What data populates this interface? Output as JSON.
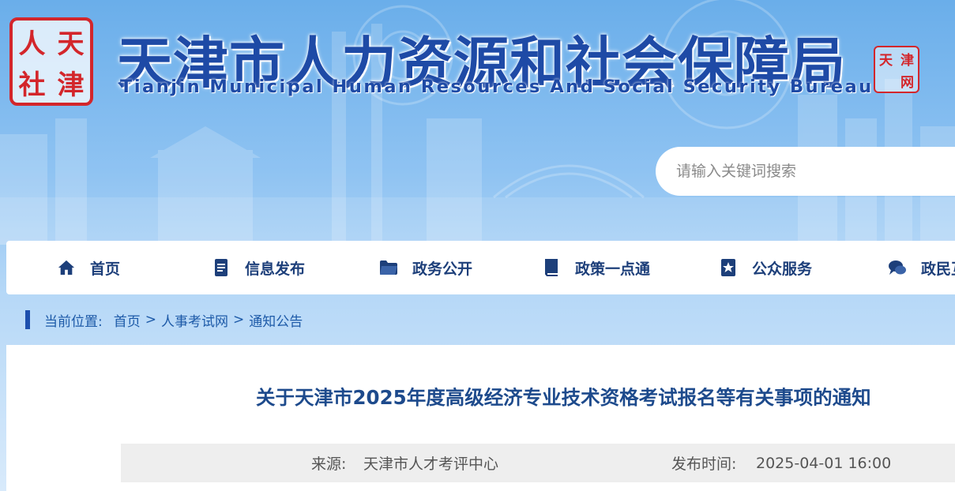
{
  "header": {
    "logo_chars": [
      "人",
      "天",
      "社",
      "津"
    ],
    "title": "天津市人力资源和社会保障局",
    "subtitle": "Tianjin Municipal Human Resources And Social Security Bureau",
    "stamp_chars": [
      "天",
      "津",
      "",
      "网"
    ]
  },
  "search": {
    "placeholder": "请输入关键词搜索"
  },
  "nav": {
    "items": [
      {
        "label": "首页",
        "icon": "home-icon"
      },
      {
        "label": "信息发布",
        "icon": "document-icon"
      },
      {
        "label": "政务公开",
        "icon": "folder-icon"
      },
      {
        "label": "政策一点通",
        "icon": "book-icon"
      },
      {
        "label": "公众服务",
        "icon": "bookmark-star-icon"
      },
      {
        "label": "政民互动",
        "icon": "chat-icon"
      }
    ]
  },
  "breadcrumb": {
    "prefix": "当前位置:",
    "items": [
      "首页",
      "人事考试网",
      "通知公告"
    ],
    "separator": ">"
  },
  "article": {
    "title": "关于天津市2025年度高级经济专业技术资格考试报名等有关事项的通知",
    "source_label": "来源:",
    "source": "天津市人才考评中心",
    "time_label": "发布时间:",
    "time": "2025-04-01 16:00"
  },
  "colors": {
    "brand_blue": "#1e4aa6",
    "seal_red": "#d3262b",
    "nav_text": "#1d3f7a"
  }
}
